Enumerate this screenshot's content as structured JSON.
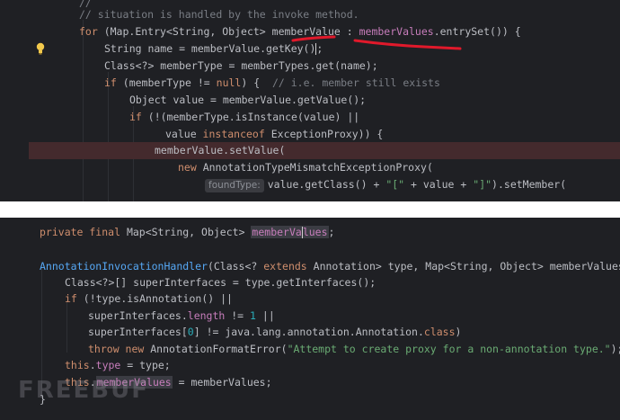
{
  "top_code": {
    "l0_comment": "// situation is handled by the invoke method.",
    "l1_for": "for",
    "l1_a": " (Map.Entry<String, Object> ",
    "l1_var": "memberValue",
    "l1_b": " : ",
    "l1_field": "memberValues",
    "l1_c": ".entrySet()) {",
    "l2_a": "String name = memberValue.getKey()",
    "l2_b": ";",
    "l3": "Class<?> memberType = memberTypes.get(name);",
    "l4_if": "if",
    "l4_a": " (memberType != ",
    "l4_null": "null",
    "l4_b": ") {  ",
    "l4_comment": "// i.e. member still exists",
    "l5": "Object value = memberValue.getValue();",
    "l6_if": "if",
    "l6_a": " (!(memberType.isInstance(value) ||",
    "l7_a": "value ",
    "l7_kw": "instanceof",
    "l7_b": " ExceptionProxy)) {",
    "l8": "memberValue.setValue(",
    "l9_new": "new",
    "l9_a": " AnnotationTypeMismatchExceptionProxy(",
    "l10_hint": "foundType:",
    "l10_a": "value.getClass() + ",
    "l10_s1": "\"[\"",
    "l10_b": " + value + ",
    "l10_s2": "\"]\"",
    "l10_c": ").setMember("
  },
  "bottom_code": {
    "b1_kw": "private final",
    "b1_a": " Map<String, Object> ",
    "b1_field_a": "memberVa",
    "b1_field_b": "lues",
    "b1_b": ";",
    "b2_ctor": "AnnotationInvocationHandler",
    "b2_a": "(Class<? ",
    "b2_kw": "extends",
    "b2_b": " Annotation> type, Map<String, Object> memberValues) {",
    "b3": "Class<?>[] superInterfaces = type.getInterfaces();",
    "b4_if": "if",
    "b4_a": " (!type.isAnnotation() ||",
    "b5_a": "superInterfaces.",
    "b5_fld": "length",
    "b5_b": " != ",
    "b5_num": "1",
    "b5_c": " ||",
    "b6_a": "superInterfaces[",
    "b6_num": "0",
    "b6_b": "] != java.lang.annotation.Annotation.",
    "b6_kw": "class",
    "b6_c": ")",
    "b7_kw": "throw new",
    "b7_a": " AnnotationFormatError(",
    "b7_str": "\"Attempt to create proxy for a non-annotation type.\"",
    "b7_b": ");",
    "b8_kw": "this",
    "b8_a": ".",
    "b8_fld": "type",
    "b8_b": " = type;",
    "b9_kw": "this",
    "b9_a": ".",
    "b9_fld": "memberValues",
    "b9_b": " = memberValues;",
    "b10": "}"
  },
  "watermark": "FREEBUF",
  "colors": {
    "background": "#1f2024",
    "keyword": "#cf8e6d",
    "field": "#c77dbb",
    "string": "#6aab73",
    "number": "#2aacb8",
    "comment": "#7a7e85",
    "annotation_red": "#e0192b"
  }
}
